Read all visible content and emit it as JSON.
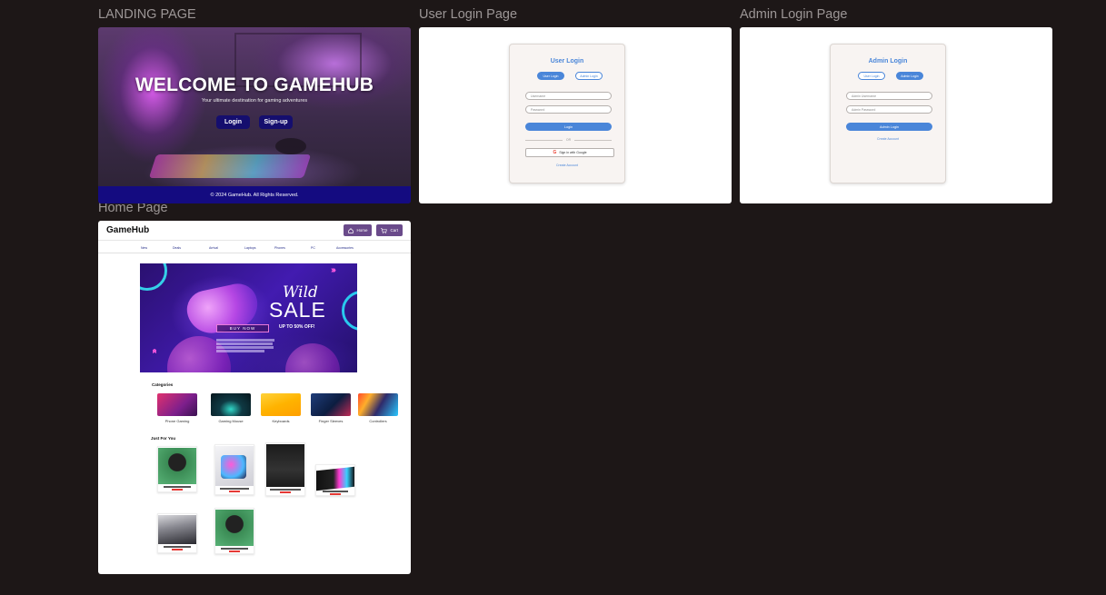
{
  "frames": {
    "landing_label": "LANDING PAGE",
    "user_login_label": "User Login Page",
    "admin_login_label": "Admin Login Page",
    "home_label": "Home Page"
  },
  "landing": {
    "title": "WELCOME TO GAMEHUB",
    "subtitle": "Your ultimate destination for gaming adventures",
    "login_button": "Login",
    "signup_button": "Sign-up",
    "footer": "© 2024 GameHub. All Rights Reserved."
  },
  "user_login": {
    "title": "User Login",
    "tab_user": "User Login",
    "tab_admin": "Admin Login",
    "username_placeholder": "Username",
    "password_placeholder": "Password",
    "login_button": "Login",
    "or_text": "OR",
    "google_button": "Sign in with Google",
    "create_account": "Create Account"
  },
  "admin_login": {
    "title": "Admin Login",
    "tab_user": "User Login",
    "tab_admin": "Admin Login",
    "username_placeholder": "Admin Username",
    "password_placeholder": "Admin Password",
    "login_button": "Admin Login",
    "create_account": "Create Account"
  },
  "home": {
    "brand": "GameHub",
    "home_button": "Home",
    "cart_button": "Cart",
    "nav": [
      "New",
      "Deals",
      "Arrival",
      "Laptops",
      "Phones",
      "PC",
      "Accessories"
    ],
    "banner": {
      "wild": "Wild",
      "sale": "SALE",
      "up_to": "UP TO 50% OFF!",
      "buy_now": "BUY NOW"
    },
    "categories_title": "Categories",
    "categories": [
      "Phone Gaming",
      "Gaming Mouse",
      "Keyboards",
      "Finger Sleeves",
      "Controllers"
    ],
    "just_for_you_title": "Just For You"
  },
  "colors": {
    "canvas": "#1d1717",
    "landing_button": "#150e6e",
    "landing_footer": "#140b80",
    "login_accent": "#4a86d9",
    "home_button": "#6a4a8a",
    "price": "#e53935"
  }
}
